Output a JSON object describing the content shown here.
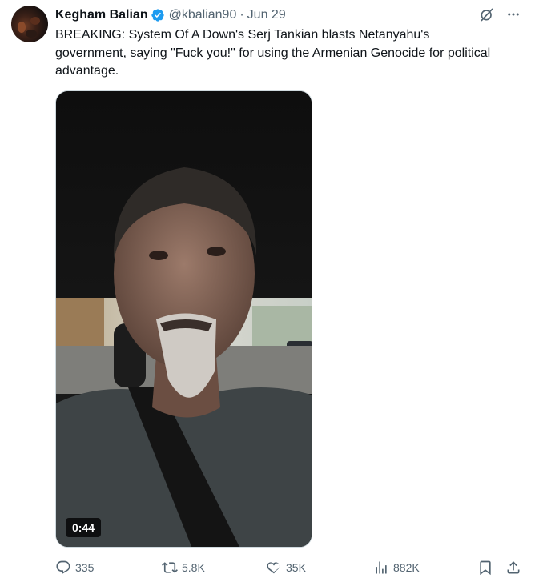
{
  "author": {
    "name": "Kegham Balian",
    "handle": "@kbalian90",
    "separator": "·",
    "date": "Jun 29"
  },
  "tweet": {
    "text": "BREAKING: System Of A Down's Serj Tankian blasts Netanyahu's government, saying \"Fuck you!\" for using the Armenian Genocide for political advantage."
  },
  "media": {
    "duration": "0:44"
  },
  "stats": {
    "replies": "335",
    "reposts": "5.8K",
    "likes": "35K",
    "views": "882K"
  },
  "icons": {
    "verified": "verified-badge-icon",
    "grok": "grok-icon",
    "more": "more-icon",
    "reply": "reply-icon",
    "repost": "repost-icon",
    "like": "heart-icon",
    "views": "views-icon",
    "bookmark": "bookmark-icon",
    "share": "share-icon"
  },
  "colors": {
    "text_primary": "#0f1419",
    "text_secondary": "#536471",
    "verified_blue": "#1d9bf0",
    "background": "#ffffff"
  }
}
